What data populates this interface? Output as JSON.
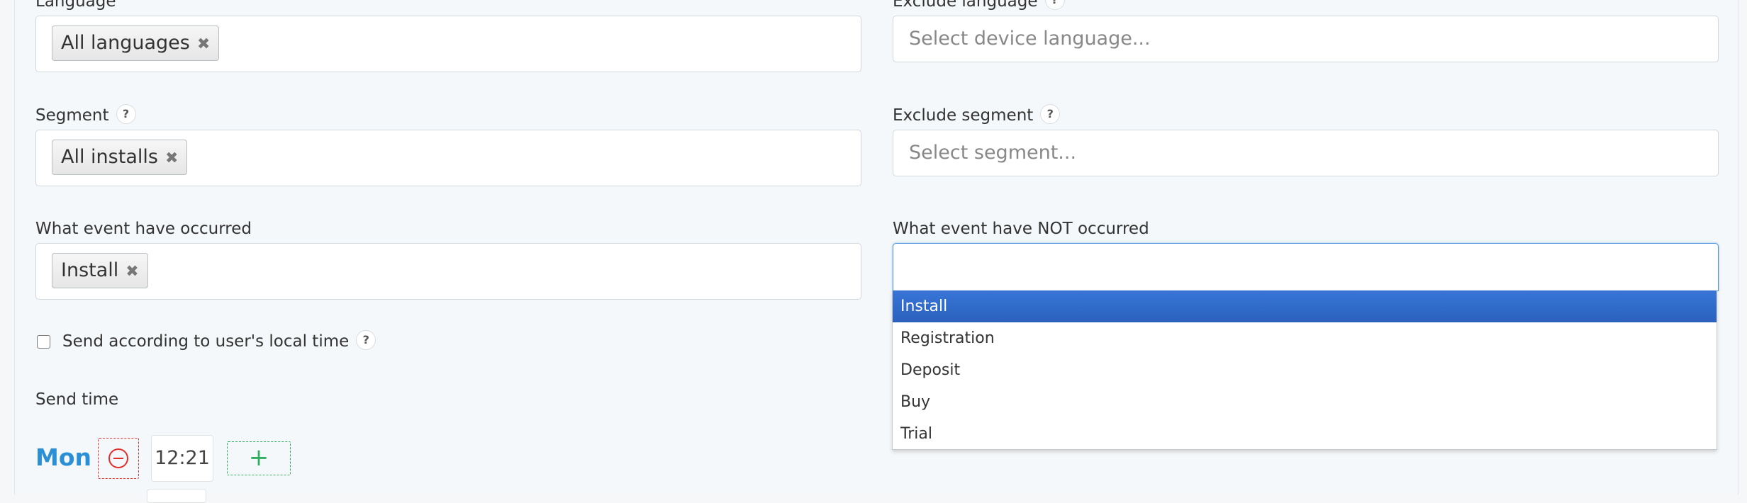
{
  "filters": {
    "language": {
      "label": "Language",
      "tags": [
        {
          "text": "All languages",
          "remove": "✖"
        }
      ]
    },
    "exclude_language": {
      "label": "Exclude language",
      "help": "?",
      "placeholder": "Select device language..."
    },
    "segment": {
      "label": "Segment",
      "help": "?",
      "tags": [
        {
          "text": "All installs",
          "remove": "✖"
        }
      ]
    },
    "exclude_segment": {
      "label": "Exclude segment",
      "help": "?",
      "placeholder": "Select segment..."
    },
    "event_occurred": {
      "label": "What event have occurred",
      "tags": [
        {
          "text": "Install",
          "remove": "✖"
        }
      ]
    },
    "event_not_occurred": {
      "label": "What event have NOT occurred",
      "value": "",
      "options": [
        "Install",
        "Registration",
        "Deposit",
        "Buy",
        "Trial"
      ],
      "highlighted_index": 0
    }
  },
  "local_time": {
    "label": "Send according to user's local time",
    "help": "?",
    "checked": false
  },
  "send_time": {
    "label": "Send time",
    "rows": [
      {
        "day": "Mon",
        "time": "12:21",
        "remove_icon": "minus-circle-icon",
        "add_label": "+"
      }
    ]
  },
  "colors": {
    "accent_blue": "#2b8fd8",
    "highlight": "#3875d7",
    "remove_red": "#e0302a",
    "add_green": "#2fae5e"
  }
}
